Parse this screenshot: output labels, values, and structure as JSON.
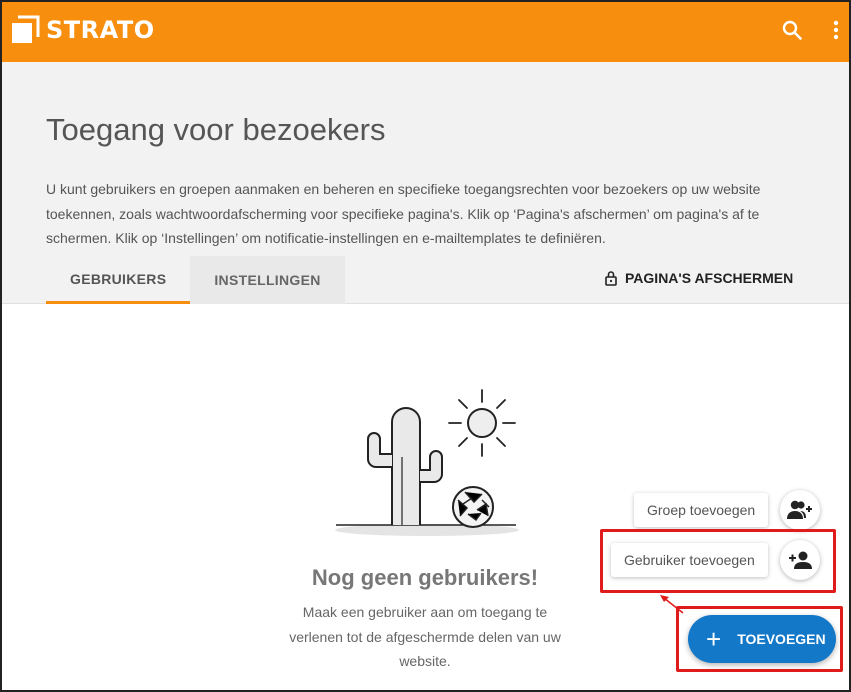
{
  "app": {
    "brand": "STRATO",
    "brand_color": "#f78e0e",
    "accent_color": "#1478c8"
  },
  "topbar": {
    "search_icon": "search-icon",
    "more_icon": "more-vert-icon"
  },
  "page": {
    "title": "Toegang voor bezoekers",
    "description": "U kunt gebruikers en groepen aanmaken en beheren en specifieke toegangsrechten voor bezoekers op uw website toekennen, zoals wachtwoordafscherming voor specifieke pagina's. Klik op ‘Pagina's afschermen’ om pagina's af te schermen. Klik op ‘Instellingen’ om notificatie-instellingen en e-mailtemplates te definiëren."
  },
  "tabs": [
    {
      "label": "GEBRUIKERS",
      "active": true
    },
    {
      "label": "INSTELLINGEN",
      "active": false
    }
  ],
  "protect_button": {
    "label": "PAGINA'S AFSCHERMEN",
    "icon": "lock-icon"
  },
  "empty_state": {
    "title": "Nog geen gebruikers!",
    "text": "Maak een gebruiker aan om toegang te verlenen tot de afgeschermde delen van uw website."
  },
  "fab_menu": {
    "add_group": {
      "label": "Groep toevoegen",
      "icon": "group-add-icon"
    },
    "add_user": {
      "label": "Gebruiker toevoegen",
      "icon": "person-add-icon"
    },
    "main": {
      "label": "TOEVOEGEN",
      "icon": "plus-icon"
    }
  },
  "highlight_color": "#e01b1b"
}
